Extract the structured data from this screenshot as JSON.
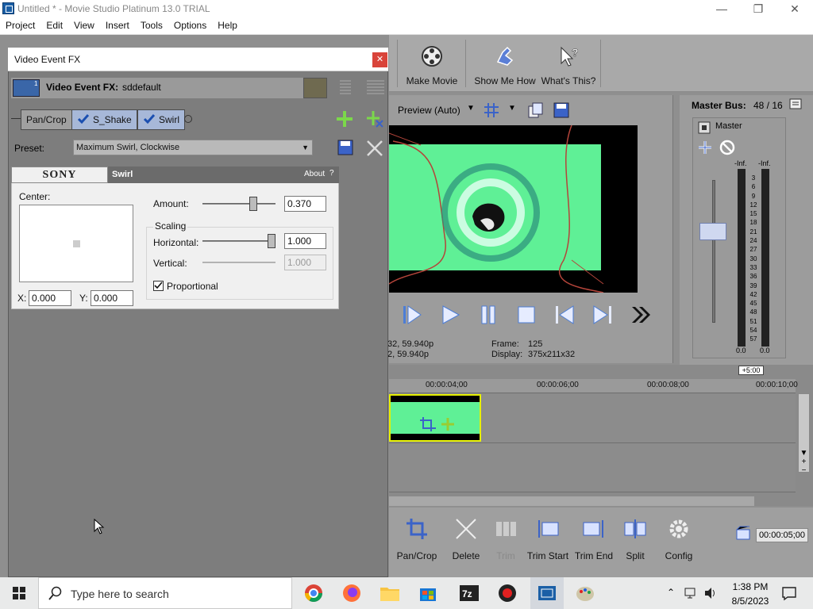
{
  "window": {
    "title": "Untitled * - Movie Studio Platinum 13.0 TRIAL"
  },
  "menu": [
    "Project",
    "Edit",
    "View",
    "Insert",
    "Tools",
    "Options",
    "Help"
  ],
  "toolbar": {
    "make_movie": "Make Movie",
    "show_me_how": "Show Me How",
    "whats_this": "What's This?"
  },
  "preview": {
    "mode": "Preview (Auto)",
    "frame_label": "Frame:",
    "frame_value": "125",
    "display_label": "Display:",
    "display_value": "375x211x32",
    "left_info1": "32, 59.940p",
    "left_info2": "2, 59.940p"
  },
  "master": {
    "title": "Master Bus:",
    "counts": "48 / 16",
    "label": "Master",
    "inf_left": "-Inf.",
    "inf_right": "-Inf.",
    "scale": [
      "3",
      "6",
      "9",
      "12",
      "15",
      "18",
      "21",
      "24",
      "27",
      "30",
      "33",
      "36",
      "39",
      "42",
      "45",
      "48",
      "51",
      "54",
      "57"
    ],
    "bottom_left": "0.0",
    "bottom_right": "0.0"
  },
  "timeline": {
    "offset": "+5:00",
    "ticks": [
      "00:00:04;00",
      "00:00:06;00",
      "00:00:08;00",
      "00:00:10;00"
    ],
    "timecode": "00:00:05;00"
  },
  "bottom_tools": {
    "pan_crop": "Pan/Crop",
    "delete": "Delete",
    "trim": "Trim",
    "trim_start": "Trim Start",
    "trim_end": "Trim End",
    "split": "Split",
    "config": "Config"
  },
  "fx": {
    "window_title": "Video Event FX",
    "header_label": "Video Event FX:",
    "header_value": "sddefault",
    "header_badge": "1",
    "chain": [
      "Pan/Crop",
      "S_Shake",
      "Swirl"
    ],
    "preset_label": "Preset:",
    "preset_value": "Maximum Swirl, Clockwise",
    "plugin": {
      "brand": "SONY",
      "name": "Swirl",
      "about": "About",
      "help": "?"
    },
    "center_label": "Center:",
    "x_label": "X:",
    "x_value": "0.000",
    "y_label": "Y:",
    "y_value": "0.000",
    "amount_label": "Amount:",
    "amount_value": "0.370",
    "amount_level": 0.72,
    "scaling_label": "Scaling",
    "horizontal_label": "Horizontal:",
    "horizontal_value": "1.000",
    "horizontal_level": 1.0,
    "vertical_label": "Vertical:",
    "vertical_value": "1.000",
    "proportional_label": "Proportional"
  },
  "taskbar": {
    "search_placeholder": "Type here to search",
    "time": "1:38 PM",
    "date": "8/5/2023"
  },
  "colors": {
    "accent_green": "#5ff096",
    "clip_border": "#e6f000",
    "close_red": "#d9443a"
  }
}
